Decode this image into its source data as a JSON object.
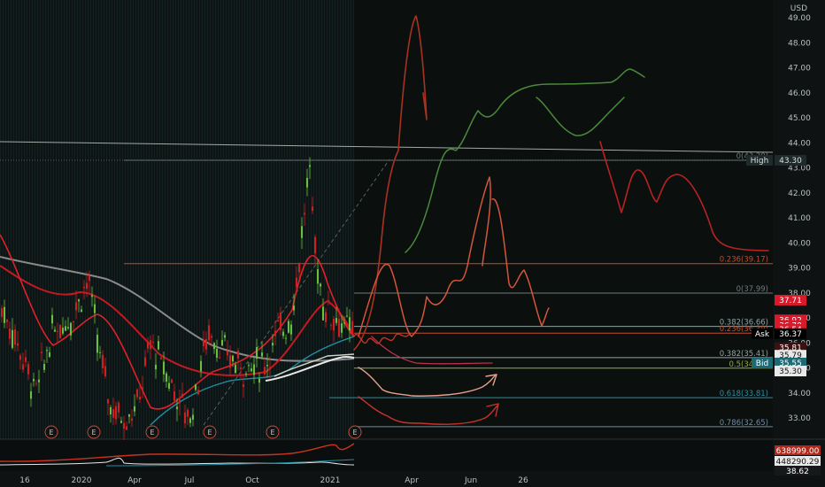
{
  "header": {
    "currency": "USD"
  },
  "price_axis": {
    "ticks": [
      "49.00",
      "48.00",
      "47.00",
      "46.00",
      "45.00",
      "44.00",
      "43.00",
      "42.00",
      "41.00",
      "40.00",
      "39.00",
      "38.00",
      "37.00",
      "36.00",
      "35.00",
      "34.00",
      "33.00"
    ],
    "tick_values": [
      49,
      48,
      47,
      46,
      45,
      44,
      43,
      42,
      41,
      40,
      39,
      38,
      37,
      36,
      35,
      34,
      33
    ]
  },
  "time_axis": {
    "labels": [
      "16",
      "2020",
      "Apr",
      "Jul",
      "Oct",
      "2021",
      "Apr",
      "Jun",
      "26"
    ]
  },
  "price_badges": [
    {
      "id": "high",
      "label": "High",
      "value": "43.30",
      "color": "#d9dcdc",
      "bg": "#1f2b2b"
    },
    {
      "id": "last",
      "value": "37.71",
      "color": "#ffffff",
      "bg": "#d81a2b"
    },
    {
      "id": "p1",
      "value": "36.92",
      "color": "#ffffff",
      "bg": "#d81a2b"
    },
    {
      "id": "p2",
      "value": "36.70",
      "color": "#ffffff",
      "bg": "#d81a2b"
    },
    {
      "id": "p3",
      "value": "36.54",
      "color": "#ffffff",
      "bg": "#d81a2b"
    },
    {
      "id": "ask",
      "label": "Ask",
      "value": "36.37",
      "color": "#ffffff",
      "bg": "#000000"
    },
    {
      "id": "p4",
      "value": "35.81",
      "color": "#ffffff",
      "bg": "#3a1212"
    },
    {
      "id": "p5",
      "value": "35.79",
      "color": "#101010",
      "bg": "#e8e8e8"
    },
    {
      "id": "bid",
      "label": "Bid",
      "value": "35.55",
      "color": "#ffffff",
      "bg": "#1b6a74"
    },
    {
      "id": "p6",
      "value": "35.30",
      "color": "#101010",
      "bg": "#e8e8e8"
    }
  ],
  "fib_levels": [
    {
      "label": "0(43.30)",
      "value": 43.3,
      "color": "#6f7a7a"
    },
    {
      "label": "0.236(39.17)",
      "value": 39.17,
      "color": "#c44a2a"
    },
    {
      "label": "0(37.99)",
      "value": 37.99,
      "color": "#6f7a7a"
    },
    {
      "label": "0.382(36.66)",
      "value": 36.66,
      "color": "#8fa3a3"
    },
    {
      "label": "0.236(36.39)",
      "value": 36.39,
      "color": "#c44a2a"
    },
    {
      "label": "0.382(35.41)",
      "value": 35.41,
      "color": "#8fa3a3"
    },
    {
      "label": "0.5(34.99)",
      "value": 34.99,
      "color": "#8cb13a"
    },
    {
      "label": "0.618(33.81)",
      "value": 33.81,
      "color": "#2a8fa0"
    },
    {
      "label": "0.786(32.65)",
      "value": 32.65,
      "color": "#6f8aa0"
    }
  ],
  "earnings_markers": [
    "E",
    "E",
    "E",
    "E",
    "E",
    "E"
  ],
  "volume_badges": [
    {
      "value": "638999.00",
      "bg": "#b3271a",
      "color": "#ffffff"
    },
    {
      "value": "448290.29",
      "bg": "#e8e8e8",
      "color": "#101010"
    },
    {
      "value": "38.62",
      "bg": "#16181a",
      "color": "#ffffff"
    }
  ]
}
